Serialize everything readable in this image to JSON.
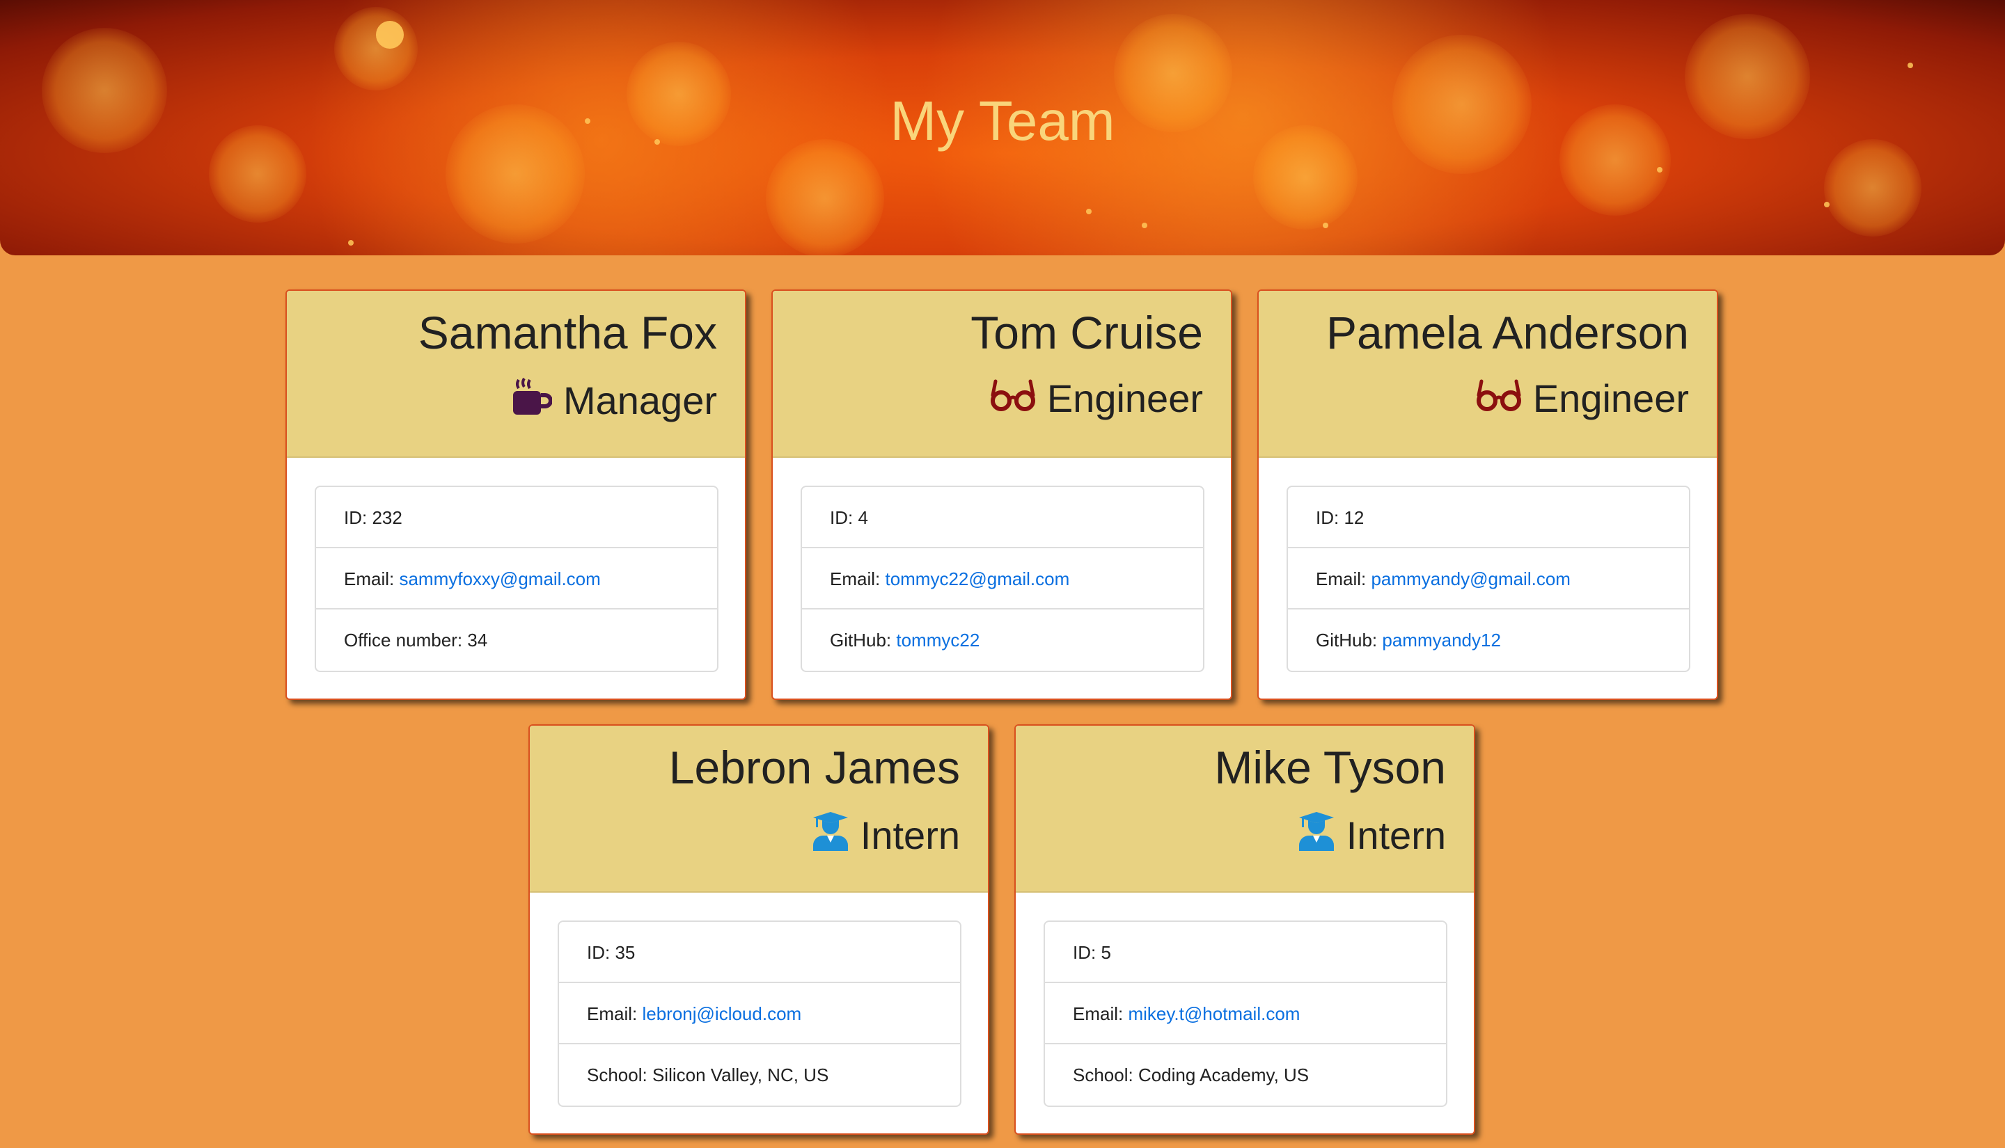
{
  "header": {
    "title": "My Team"
  },
  "colors": {
    "page_background": "#EF9946",
    "card_header": "#E8D282",
    "link": "#0A6FE0",
    "manager_icon": "#4A1548",
    "engineer_icon": "#8B0F0F",
    "intern_icon": "#1E90D6"
  },
  "cards": [
    {
      "name": "Samantha Fox",
      "role": "Manager",
      "icon": "coffee-mug-icon",
      "id_label": "ID: 232",
      "email_prefix": "Email:",
      "email": "sammyfoxxy@gmail.com",
      "extra_prefix": "Office number: 34",
      "extra_value": ""
    },
    {
      "name": "Tom Cruise",
      "role": "Engineer",
      "icon": "glasses-icon",
      "id_label": "ID: 4",
      "email_prefix": "Email:",
      "email": "tommyc22@gmail.com",
      "extra_prefix": "GitHub:",
      "extra_value": "tommyc22"
    },
    {
      "name": "Pamela Anderson",
      "role": "Engineer",
      "icon": "glasses-icon",
      "id_label": "ID: 12",
      "email_prefix": "Email:",
      "email": "pammyandy@gmail.com",
      "extra_prefix": "GitHub:",
      "extra_value": "pammyandy12"
    },
    {
      "name": "Lebron James",
      "role": "Intern",
      "icon": "graduate-icon",
      "id_label": "ID: 35",
      "email_prefix": "Email:",
      "email": "lebronj@icloud.com",
      "extra_prefix": "School: Silicon Valley, NC, US",
      "extra_value": ""
    },
    {
      "name": "Mike Tyson",
      "role": "Intern",
      "icon": "graduate-icon",
      "id_label": "ID: 5",
      "email_prefix": "Email:",
      "email": "mikey.t@hotmail.com",
      "extra_prefix": "School: Coding Academy, US",
      "extra_value": ""
    }
  ]
}
